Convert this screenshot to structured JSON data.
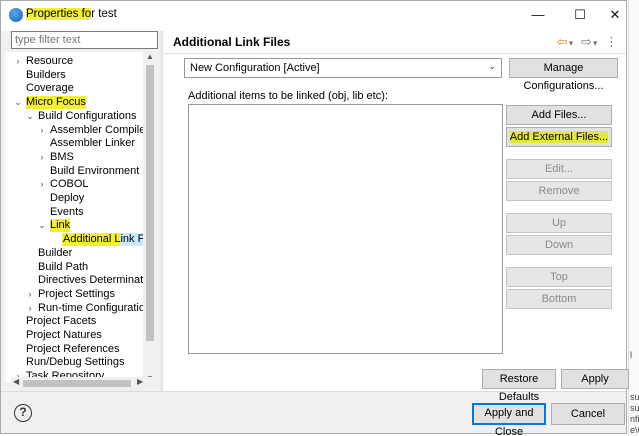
{
  "window": {
    "title_prefix": "Properties fo",
    "title_suffix": "r test",
    "minimize_glyph": "—",
    "maximize_glyph": "☐",
    "close_glyph": "✕",
    "icon": "eclipse-app-icon"
  },
  "filter": {
    "placeholder": "type filter text"
  },
  "tree": [
    {
      "label": "Resource",
      "arrow": "›"
    },
    {
      "label": "Builders",
      "arrow": ""
    },
    {
      "label": "Coverage",
      "arrow": ""
    },
    {
      "label": "Micro Focus",
      "arrow": "⌄",
      "highlight": true
    },
    {
      "label": "Build Configurations",
      "arrow": "⌄"
    },
    {
      "label": "Assembler Compiler",
      "arrow": "›"
    },
    {
      "label": "Assembler Linker",
      "arrow": ""
    },
    {
      "label": "BMS",
      "arrow": "›"
    },
    {
      "label": "Build Environment",
      "arrow": ""
    },
    {
      "label": "COBOL",
      "arrow": "›"
    },
    {
      "label": "Deploy",
      "arrow": ""
    },
    {
      "label": "Events",
      "arrow": ""
    },
    {
      "label": "Link",
      "arrow": "⌄",
      "highlight": true
    },
    {
      "label": "Additional Link Files",
      "arrow": "",
      "selected": true
    },
    {
      "label": "Builder",
      "arrow": ""
    },
    {
      "label": "Build Path",
      "arrow": ""
    },
    {
      "label": "Directives Determination",
      "arrow": ""
    },
    {
      "label": "Project Settings",
      "arrow": "›"
    },
    {
      "label": "Run-time Configuration",
      "arrow": "›"
    },
    {
      "label": "Project Facets",
      "arrow": ""
    },
    {
      "label": "Project Natures",
      "arrow": ""
    },
    {
      "label": "Project References",
      "arrow": ""
    },
    {
      "label": "Run/Debug Settings",
      "arrow": ""
    },
    {
      "label": "Task Repository",
      "arrow": "›"
    }
  ],
  "page": {
    "title": "Additional Link Files",
    "nav_back": "⇦",
    "nav_back_menu": "▾",
    "nav_forward": "⇨",
    "nav_forward_menu": "▾",
    "view_menu": "⋮"
  },
  "configuration": {
    "selected": "New Configuration  [Active]",
    "manage_label": "Manage Configurations..."
  },
  "list": {
    "label": "Additional items to be linked (obj, lib etc):"
  },
  "buttons": {
    "add_files": "Add Files...",
    "add_external_files": "Add External Files...",
    "edit": "Edit...",
    "remove": "Remove",
    "up": "Up",
    "down": "Down",
    "top": "Top",
    "bottom": "Bottom",
    "restore_defaults": "Restore Defaults",
    "apply": "Apply",
    "apply_and_close": "Apply and Close",
    "cancel": "Cancel",
    "help": "?"
  },
  "background_text": [
    "l",
    "su",
    "su",
    "nfig",
    "e\\C"
  ],
  "colors": {
    "highlight": "#f3f033",
    "selection": "#cce8ff",
    "accent": "#0078d7"
  }
}
